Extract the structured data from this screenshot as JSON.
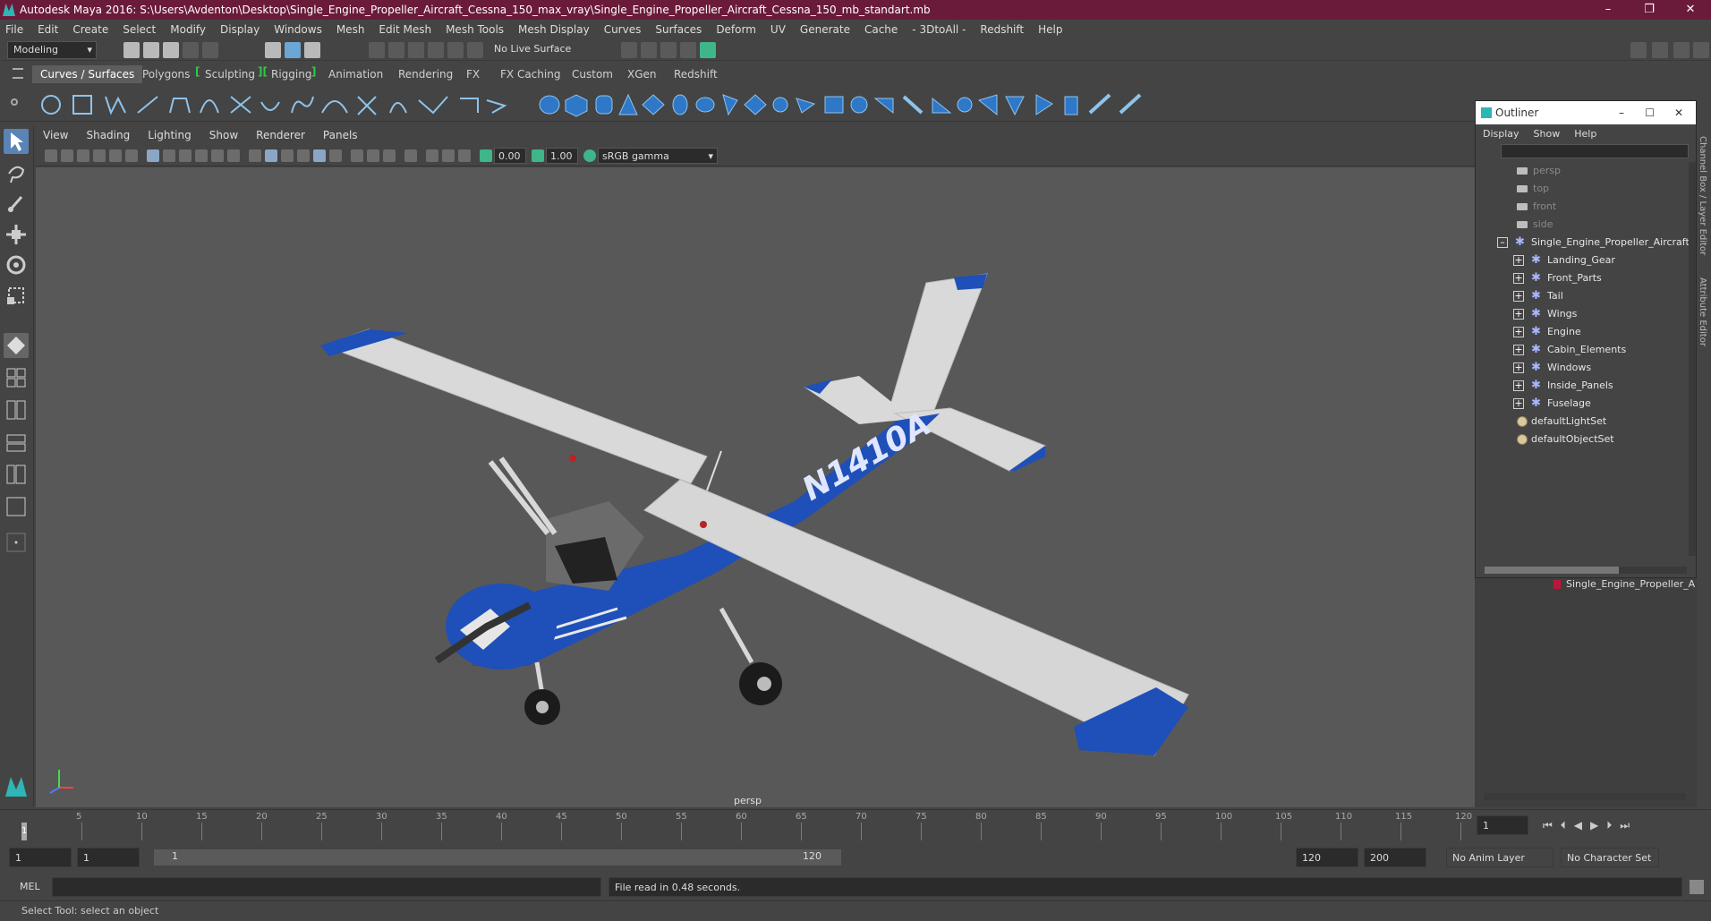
{
  "window": {
    "title": "Autodesk Maya 2016: S:\\Users\\Avdenton\\Desktop\\Single_Engine_Propeller_Aircraft_Cessna_150_max_vray\\Single_Engine_Propeller_Aircraft_Cessna_150_mb_standart.mb",
    "min": "–",
    "max": "❐",
    "close": "✕"
  },
  "menubar": [
    "File",
    "Edit",
    "Create",
    "Select",
    "Modify",
    "Display",
    "Windows",
    "Mesh",
    "Edit Mesh",
    "Mesh Tools",
    "Mesh Display",
    "Curves",
    "Surfaces",
    "Deform",
    "UV",
    "Generate",
    "Cache",
    "- 3DtoAll -",
    "Redshift",
    "Help"
  ],
  "statusline": {
    "mode": "Modeling",
    "live_surface": "No Live Surface"
  },
  "shelf_tabs": [
    "Curves / Surfaces",
    "Polygons",
    "Sculpting",
    "Rigging",
    "Animation",
    "Rendering",
    "FX",
    "FX Caching",
    "Custom",
    "XGen",
    "Redshift"
  ],
  "panel_menu": [
    "View",
    "Shading",
    "Lighting",
    "Show",
    "Renderer",
    "Panels"
  ],
  "panel_toolbar": {
    "exposure": "0.00",
    "gamma": "1.00",
    "color_space": "sRGB gamma"
  },
  "viewport": {
    "camera_label": "persp",
    "tail_number": "N1410A"
  },
  "outliner": {
    "title": "Outliner",
    "menus": [
      "Display",
      "Show",
      "Help"
    ],
    "cameras": [
      "persp",
      "top",
      "front",
      "side"
    ],
    "root": "Single_Engine_Propeller_Aircraft_",
    "children": [
      "Landing_Gear",
      "Front_Parts",
      "Tail",
      "Wings",
      "Engine",
      "Cabin_Elements",
      "Windows",
      "Inside_Panels",
      "Fuselage"
    ],
    "sets": [
      "defaultLightSet",
      "defaultObjectSet"
    ]
  },
  "side_tabs": [
    "Channel Box / Layer Editor",
    "Attribute Editor"
  ],
  "layer_item": "Single_Engine_Propeller_A",
  "timeslider": {
    "ticks": [
      "5",
      "10",
      "15",
      "20",
      "25",
      "30",
      "35",
      "40",
      "45",
      "50",
      "55",
      "60",
      "65",
      "70",
      "75",
      "80",
      "85",
      "90",
      "95",
      "100",
      "105",
      "110",
      "115",
      "120"
    ],
    "current_marker": "1",
    "current_frame": "1"
  },
  "range": {
    "start": "1",
    "anim_start": "1",
    "slider_start": "1",
    "slider_end": "120",
    "end": "120",
    "anim_end": "200",
    "anim_layer": "No Anim Layer",
    "character_set": "No Character Set"
  },
  "command": {
    "lang": "MEL",
    "result": "File read in  0.48 seconds."
  },
  "helpline": "Select Tool: select an object",
  "colors": {
    "title_bar": "#6b1b3a",
    "plane_blue": "#1f4fb8",
    "plane_white": "#d8d8d8",
    "viewport_bg": "#585858"
  }
}
